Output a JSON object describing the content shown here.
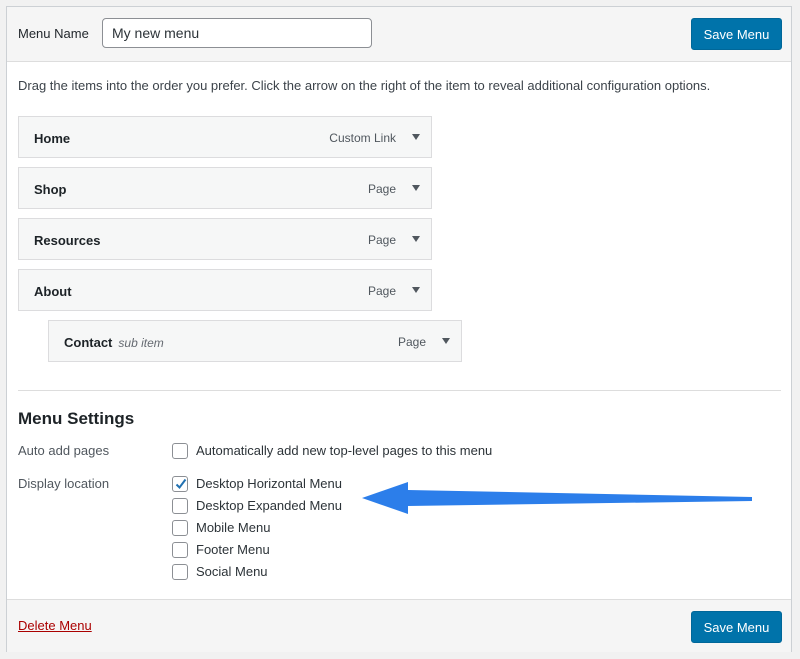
{
  "header": {
    "menu_name_label": "Menu Name",
    "menu_name_value": "My new menu",
    "save_label": "Save Menu"
  },
  "instructions": "Drag the items into the order you prefer. Click the arrow on the right of the item to reveal additional configuration options.",
  "menu_items": [
    {
      "title": "Home",
      "type": "Custom Link"
    },
    {
      "title": "Shop",
      "type": "Page"
    },
    {
      "title": "Resources",
      "type": "Page"
    },
    {
      "title": "About",
      "type": "Page"
    },
    {
      "title": "Contact",
      "subtitle": "sub item",
      "type": "Page"
    }
  ],
  "settings": {
    "title": "Menu Settings",
    "auto_add": {
      "label": "Auto add pages",
      "option": "Automatically add new top-level pages to this menu",
      "checked": false
    },
    "display_location": {
      "label": "Display location",
      "options": [
        {
          "label": "Desktop Horizontal Menu",
          "checked": true
        },
        {
          "label": "Desktop Expanded Menu",
          "checked": false
        },
        {
          "label": "Mobile Menu",
          "checked": false
        },
        {
          "label": "Footer Menu",
          "checked": false
        },
        {
          "label": "Social Menu",
          "checked": false
        }
      ]
    }
  },
  "footer": {
    "delete_label": "Delete Menu",
    "save_label": "Save Menu"
  },
  "colors": {
    "primary_button": "#0073aa",
    "delete_link": "#aa0000",
    "annotation_arrow": "#1a73e8"
  }
}
